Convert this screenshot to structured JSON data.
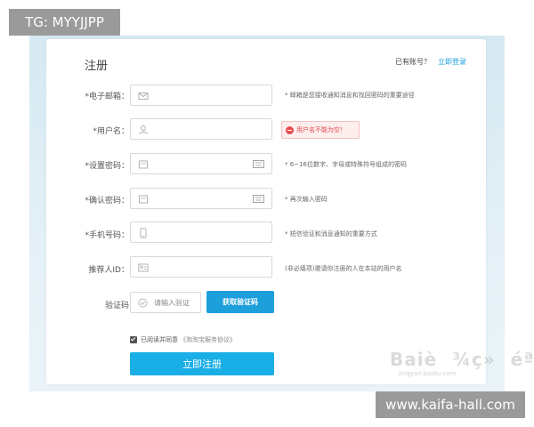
{
  "watermarks": {
    "top_left": "TG: MYYJJPP",
    "bottom_right": "www.kaifa-hall.com",
    "baidu": "Baiè¾ç»éª",
    "baidu_sub": "jingyan.baidu.com"
  },
  "form": {
    "title": "注册",
    "have_account": "已有账号？",
    "login_link": "立即登录",
    "fields": [
      {
        "label": "*电子邮箱：",
        "icon": "email-icon",
        "hint": "* 邮箱是您接收通知消息和找回密码的重要途径"
      },
      {
        "label": "*用户名：",
        "icon": "user-icon",
        "error": "用户名不能为空！"
      },
      {
        "label": "*设置密码：",
        "icon": "lock-icon",
        "right_icon": "keyboard-icon",
        "hint": "* 6~16位数字、字母或特殊符号组成的密码"
      },
      {
        "label": "*确认密码：",
        "icon": "lock-icon",
        "right_icon": "keyboard-icon",
        "hint": "* 再次输入密码"
      },
      {
        "label": "*手机号码：",
        "icon": "phone-icon",
        "hint": "* 短信验证和消息通知的重要方式"
      },
      {
        "label": "推荐人ID：",
        "icon": "id-card-icon",
        "hint": "(非必填项)邀请你注册的人在本站的用户名"
      }
    ],
    "captcha": {
      "label": "验证码",
      "placeholder": "请输入验证",
      "button": "获取验证码"
    },
    "agree": {
      "text": "已阅读并同意",
      "protocol": "《淘淘宝服务协议》"
    },
    "submit": "立即注册"
  },
  "colors": {
    "accent": "#1aaee6",
    "button": "#1d9fdc",
    "error": "#e04a4a",
    "backdrop": "#d6e9f2"
  }
}
